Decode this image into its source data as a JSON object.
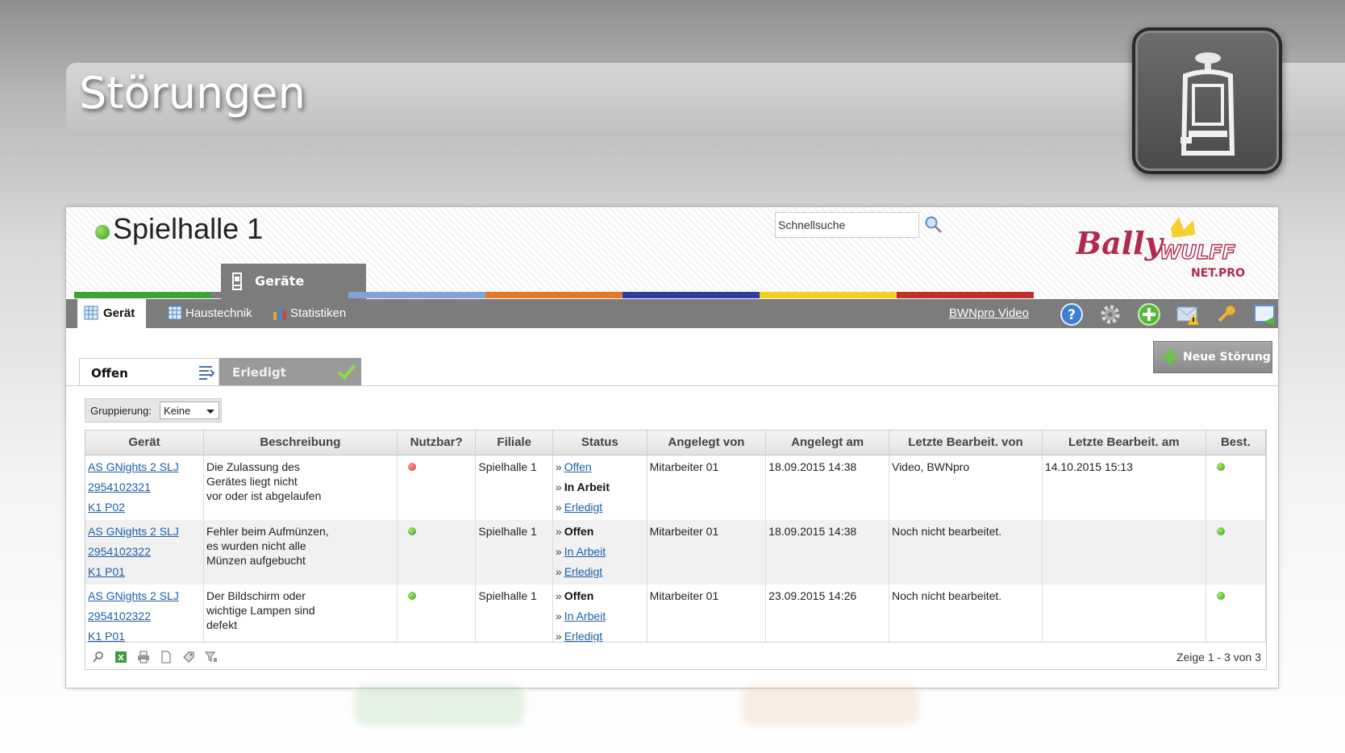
{
  "page": {
    "title": "Störungen"
  },
  "hall": {
    "name": "Spielhalle 1"
  },
  "search": {
    "placeholder": "Schnellsuche"
  },
  "logo": {
    "line1": "Bally",
    "line2": "WULFF",
    "line3": "NET.PRO"
  },
  "module_tab": {
    "label": "Geräte"
  },
  "nav": {
    "items": [
      {
        "label": "Gerät",
        "active": true
      },
      {
        "label": "Haustechnik",
        "active": false
      },
      {
        "label": "Statistiken",
        "active": false
      }
    ],
    "video_link": "BWNpro Video"
  },
  "tabs": {
    "open": "Offen",
    "done": "Erledigt"
  },
  "new_button": {
    "label": "Neue Störung"
  },
  "grouping": {
    "label": "Gruppierung:",
    "value": "Keine"
  },
  "table": {
    "columns": [
      "Gerät",
      "Beschreibung",
      "Nutzbar?",
      "Filiale",
      "Status",
      "Angelegt von",
      "Angelegt am",
      "Letzte Bearbeit. von",
      "Letzte Bearbeit. am",
      "Best."
    ],
    "rows": [
      {
        "device": [
          "AS GNights 2 SLJ",
          "2954102321",
          "K1 P02"
        ],
        "description": [
          "Die Zulassung des",
          "Gerätes liegt nicht",
          "vor oder ist abgelaufen"
        ],
        "usable": "red",
        "branch": "Spielhalle 1",
        "status": [
          "Offen",
          "In Arbeit",
          "Erledigt"
        ],
        "status_current": "In Arbeit",
        "created_by": "Mitarbeiter 01",
        "created_at": "18.09.2015 14:38",
        "last_edit_by": "Video, BWNpro",
        "last_edit_at": "14.10.2015 15:13",
        "confirmed": "green"
      },
      {
        "device": [
          "AS GNights 2 SLJ",
          "2954102322",
          "K1 P01"
        ],
        "description": [
          "Fehler beim Aufmünzen,",
          "es wurden nicht alle",
          "Münzen aufgebucht"
        ],
        "usable": "green",
        "branch": "Spielhalle 1",
        "status": [
          "Offen",
          "In Arbeit",
          "Erledigt"
        ],
        "status_current": "Offen",
        "created_by": "Mitarbeiter 01",
        "created_at": "18.09.2015 14:38",
        "last_edit_by": "Noch nicht bearbeitet.",
        "last_edit_at": "",
        "confirmed": "green"
      },
      {
        "device": [
          "AS GNights 2 SLJ",
          "2954102322",
          "K1 P01"
        ],
        "description": [
          "Der Bildschirm oder",
          "wichtige Lampen sind",
          "defekt"
        ],
        "usable": "green",
        "branch": "Spielhalle 1",
        "status": [
          "Offen",
          "In Arbeit",
          "Erledigt"
        ],
        "status_current": "Offen",
        "created_by": "Mitarbeiter 01",
        "created_at": "23.09.2015 14:26",
        "last_edit_by": "Noch nicht bearbeitet.",
        "last_edit_at": "",
        "confirmed": "green"
      }
    ],
    "pager": "Zeige 1 - 3 von 3"
  },
  "colors": {
    "strip": [
      "#3aa335",
      "#7c7c7c",
      "#7ea4d8",
      "#e07b2a",
      "#2e3d9e",
      "#f0d020",
      "#c0302a"
    ],
    "toolbar_bg": "#7c7c7c",
    "link": "#1a5fa8"
  }
}
